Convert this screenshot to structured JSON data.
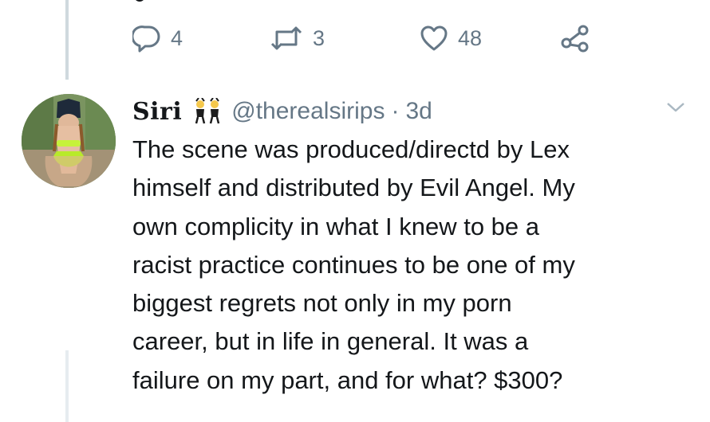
{
  "previous_tweet": {
    "actions": {
      "reply_count": "4",
      "retweet_count": "3",
      "like_count": "48"
    }
  },
  "tweet": {
    "display_name": "Siri",
    "handle": "@therealsirips",
    "separator": "·",
    "timestamp": "3d",
    "text": "The scene was produced/directd by Lex\nhimself and distributed by Evil Angel. My\nown complicity in what I knew to be a\nracist practice continues to be one of my\nbiggest regrets not only in my porn\ncareer, but in life in general. It was a\nfailure on my part, and for what? $300?"
  },
  "icons": {
    "reply": "reply-icon",
    "retweet": "retweet-icon",
    "like": "heart-icon",
    "share": "share-icon",
    "caret": "chevron-down-icon",
    "name_emoji": "dancers-emoji-icon"
  },
  "colors": {
    "text_primary": "#14171a",
    "text_secondary": "#657786",
    "thread_line": "#cfd9de"
  }
}
